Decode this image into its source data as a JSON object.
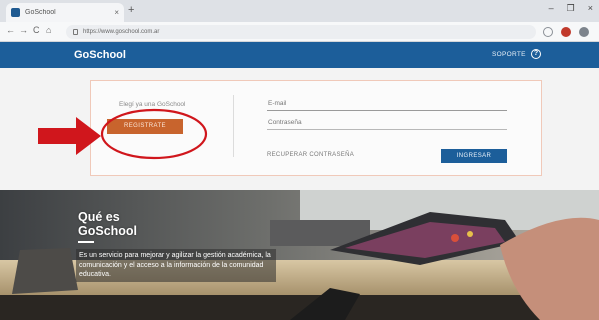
{
  "browser": {
    "tab_title": "GoSchool",
    "tab_close": "×",
    "new_tab": "+",
    "window_controls": [
      "–",
      "❐",
      "×"
    ],
    "nav": {
      "back": "←",
      "forward": "→",
      "reload": "C",
      "home": "⌂"
    },
    "url": "https://www.goschool.com.ar"
  },
  "header": {
    "logo": "GoSchool",
    "support_label": "SOPORTE",
    "help_icon": "?"
  },
  "login": {
    "signup_prompt": "Elegí ya una GoSchool",
    "signup_button": "REGISTRATE",
    "email_placeholder": "E-mail",
    "password_placeholder": "Contraseña",
    "recover_link": "RECUPERAR CONTRASEÑA",
    "login_button": "INGRESAR"
  },
  "hero": {
    "title_line1": "Qué es",
    "title_line2": "GoSchool",
    "description": "Es un servicio para mejorar y agilizar la gestión académica, la comunicación y el acceso a la información de la comunidad educativa."
  },
  "colors": {
    "header_blue": "#1c5e9a",
    "signup_orange": "#c8642d",
    "annotation_red": "#d0161c"
  }
}
